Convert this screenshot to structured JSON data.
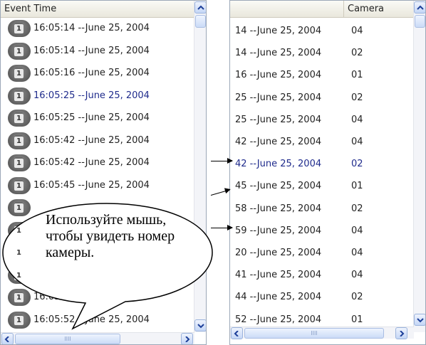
{
  "left_panel": {
    "header": "Event Time",
    "rows": [
      {
        "icon": "1",
        "time": "16:05:14 --June 25, 2004"
      },
      {
        "icon": "1",
        "time": "16:05:14 --June 25, 2004"
      },
      {
        "icon": "1",
        "time": "16:05:16 --June 25, 2004"
      },
      {
        "icon": "1",
        "time": "16:05:25 --June 25, 2004",
        "selected": true
      },
      {
        "icon": "1",
        "time": "16:05:25 --June 25, 2004"
      },
      {
        "icon": "1",
        "time": "16:05:42 --June 25, 2004"
      },
      {
        "icon": "1",
        "time": "16:05:42 --June 25, 2004"
      },
      {
        "icon": "1",
        "time": "16:05:45 --June 25, 2004"
      },
      {
        "icon": "1",
        "time": ""
      },
      {
        "icon": "1",
        "time": ""
      },
      {
        "icon": "1",
        "time": ""
      },
      {
        "icon": "1",
        "time": ""
      },
      {
        "icon": "1",
        "time": "16:05:52 --June 25, 2004"
      },
      {
        "icon": "1",
        "time": "16:05:52 --June 25, 2004"
      }
    ]
  },
  "right_panel": {
    "header_blank": "",
    "header_camera": "Camera",
    "rows": [
      {
        "time": "14 --June 25, 2004",
        "camera": "04"
      },
      {
        "time": "14 --June 25, 2004",
        "camera": "02"
      },
      {
        "time": "16 --June 25, 2004",
        "camera": "01"
      },
      {
        "time": "25 --June 25, 2004",
        "camera": "02"
      },
      {
        "time": "25 --June 25, 2004",
        "camera": "04"
      },
      {
        "time": "42 --June 25, 2004",
        "camera": "04"
      },
      {
        "time": "42 --June 25, 2004",
        "camera": "02",
        "selected": true
      },
      {
        "time": "45 --June 25, 2004",
        "camera": "01"
      },
      {
        "time": "58 --June 25, 2004",
        "camera": "02"
      },
      {
        "time": "59 --June 25, 2004",
        "camera": "04"
      },
      {
        "time": "20 --June 25, 2004",
        "camera": "04"
      },
      {
        "time": "41 --June 25, 2004",
        "camera": "04"
      },
      {
        "time": "44 --June 25, 2004",
        "camera": "02"
      },
      {
        "time": "52 --June 25, 2004",
        "camera": "01"
      }
    ]
  },
  "callout": {
    "text": "Используйте мышь, чтобы увидеть номер камеры."
  },
  "scrollbar": {
    "grip": "IIII"
  },
  "colors": {
    "selected_text": "#1f2b8c",
    "panel_border": "#9ca8b8"
  }
}
